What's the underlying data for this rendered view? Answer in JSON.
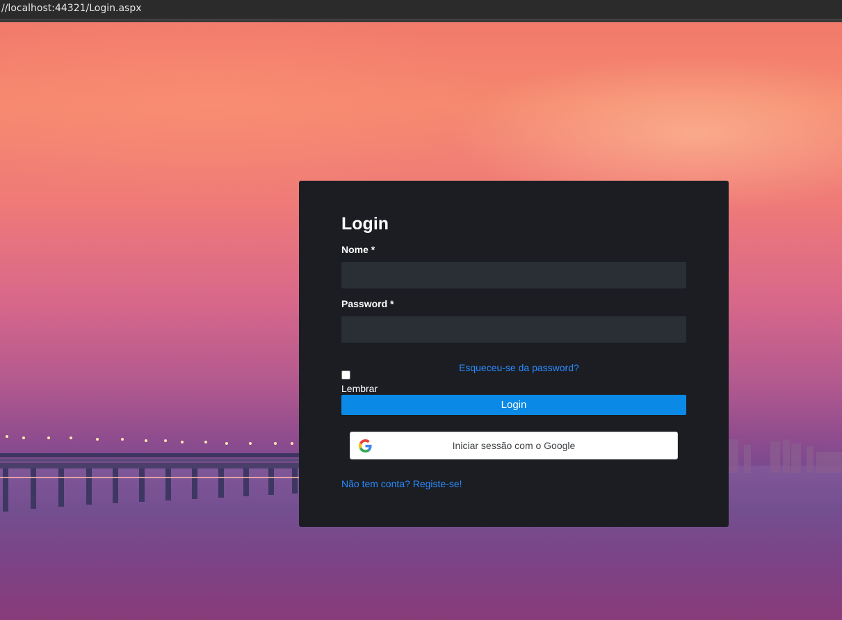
{
  "browser": {
    "address": "//localhost:44321/Login.aspx"
  },
  "login": {
    "title": "Login",
    "name_label": "Nome *",
    "password_label": "Password *",
    "forgot_link": "Esqueceu-se da password?",
    "remember_label": "Lembrar",
    "login_button": "Login",
    "google_button": "Iniciar sessão com o Google",
    "register_link": "Não tem conta? Registe-se!"
  },
  "colors": {
    "card_background": "#1b1d23",
    "input_background": "#2a2f36",
    "primary_button": "#0a8ae6",
    "link": "#2b8cff"
  }
}
